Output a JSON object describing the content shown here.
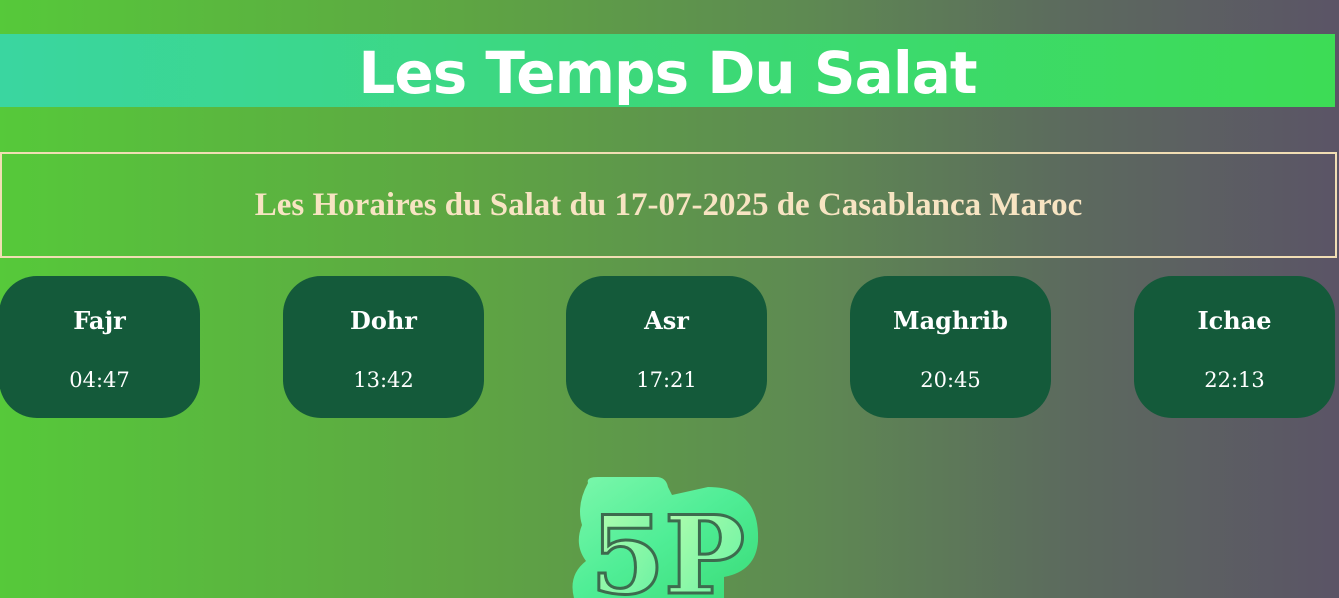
{
  "header": {
    "title": "Les Temps Du Salat"
  },
  "subtitle": "Les Horaires du Salat du 17-07-2025 de Casablanca Maroc",
  "prayers": [
    {
      "name": "Fajr",
      "time": "04:47"
    },
    {
      "name": "Dohr",
      "time": "13:42"
    },
    {
      "name": "Asr",
      "time": "17:21"
    },
    {
      "name": "Maghrib",
      "time": "20:45"
    },
    {
      "name": "Ichae",
      "time": "22:13"
    }
  ],
  "logo": {
    "text": "5P",
    "icon": "5p-logo-icon"
  },
  "colors": {
    "banner": "#3ddc55",
    "card": "#145a3a",
    "subtitle": "#f7e4c2"
  }
}
